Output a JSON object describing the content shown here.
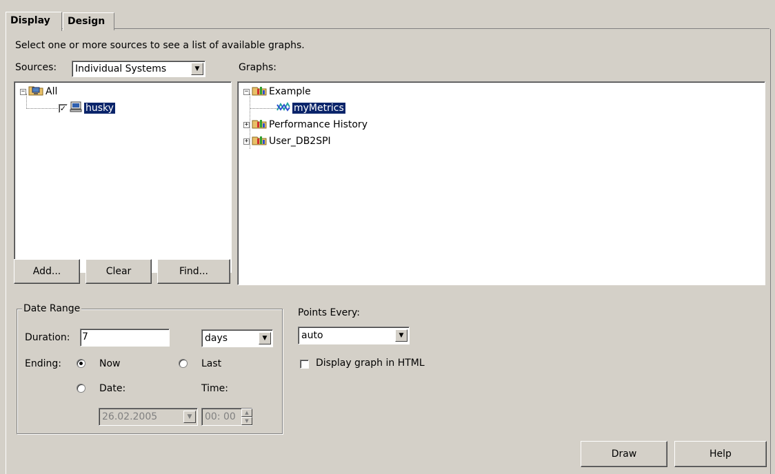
{
  "tabs": [
    {
      "label": "Display",
      "active": true
    },
    {
      "label": "Design",
      "active": false
    }
  ],
  "instruction": "Select one or more sources to see a list of available graphs.",
  "sources": {
    "label": "Sources:",
    "selected": "Individual Systems",
    "tree": {
      "root": "All",
      "children": [
        {
          "label": "husky",
          "checked": true,
          "selected": true
        }
      ]
    },
    "buttons": {
      "add": "Add...",
      "clear": "Clear",
      "find": "Find..."
    }
  },
  "graphs": {
    "label": "Graphs:",
    "tree": [
      {
        "label": "Example",
        "expanded": true,
        "children": [
          {
            "label": "myMetrics",
            "selected": true
          }
        ]
      },
      {
        "label": "Performance History",
        "expanded": false
      },
      {
        "label": "User_DB2SPI",
        "expanded": false
      }
    ]
  },
  "date_range": {
    "legend": "Date Range",
    "duration_label": "Duration:",
    "duration_value": "7",
    "unit_selected": "days",
    "ending_label": "Ending:",
    "now_label": "Now",
    "last_label": "Last",
    "date_label": "Date:",
    "time_label": "Time:",
    "date_value": "26.02.2005",
    "time_value": "00: 00",
    "selected_option": "Now"
  },
  "points_every": {
    "label": "Points Every:",
    "selected": "auto"
  },
  "display_html": {
    "label": "Display graph in HTML",
    "checked": false
  },
  "footer": {
    "draw": "Draw",
    "help": "Help"
  },
  "colors": {
    "selection": "#0a246a",
    "background": "#d4d0c8"
  }
}
